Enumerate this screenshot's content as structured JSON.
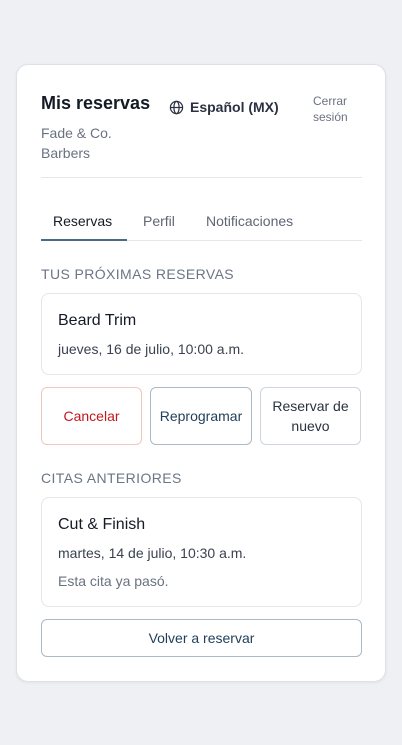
{
  "header": {
    "title": "Mis reservas",
    "business_name": "Fade & Co. Barbers",
    "language": "Español (MX)",
    "logout_label": "Cerrar sesión"
  },
  "tabs": [
    {
      "label": "Reservas",
      "active": true
    },
    {
      "label": "Perfil",
      "active": false
    },
    {
      "label": "Notificaciones",
      "active": false
    }
  ],
  "upcoming": {
    "section_label": "TUS PRÓXIMAS RESERVAS",
    "appointment": {
      "service": "Beard Trim",
      "datetime": "jueves, 16 de julio, 10:00 a.m."
    },
    "actions": {
      "cancel_label": "Cancelar",
      "reschedule_label": "Reprogramar",
      "book_again_label": "Reservar de nuevo"
    }
  },
  "past": {
    "section_label": "CITAS ANTERIORES",
    "appointment": {
      "service": "Cut & Finish",
      "datetime": "martes, 14 de julio, 10:30 a.m.",
      "note": "Esta cita ya pasó."
    },
    "rebook_label": "Volver a reservar"
  },
  "colors": {
    "accent": "#4a6a86",
    "danger": "#c0191f",
    "background": "#eef0f4"
  },
  "icons": {
    "language": "globe-icon"
  }
}
